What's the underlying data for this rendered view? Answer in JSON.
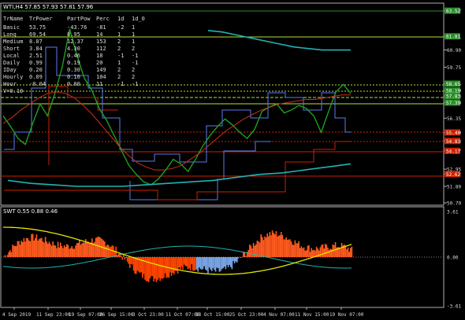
{
  "main_panel": {
    "title": "WTI,H4  57.85 57.93 57.81 57.96",
    "table": {
      "headers": [
        "TrName",
        "TrPower",
        "PartPow",
        "Perc",
        "1d",
        "1d_0"
      ],
      "rows": [
        [
          "Basic",
          "53.75",
          "-43.76",
          "-81",
          "-2",
          "1"
        ],
        [
          "Long",
          "69.54",
          "8.95",
          "14",
          "1",
          "1"
        ],
        [
          "Medium",
          "8.07",
          "12.37",
          "153",
          "2",
          "1"
        ],
        [
          "Short",
          "3.84",
          "4.30",
          "112",
          "2",
          "2"
        ],
        [
          "Local",
          "2.51",
          "0.46",
          "18",
          "-1",
          "-1"
        ],
        [
          "Daily",
          "0.99",
          "0.19",
          "20",
          "1",
          "-1"
        ],
        [
          "IDay",
          "0.20",
          "0.30",
          "149",
          "2",
          "2"
        ],
        [
          "Hourly",
          "0.09",
          "0.10",
          "104",
          "2",
          "2"
        ],
        [
          "Hour",
          "-0.04",
          "0.00",
          "11",
          "-1",
          "-1"
        ]
      ],
      "extra": "V=0.10"
    },
    "y_ticks": [
      "63.52",
      "61.81",
      "60.90",
      "59.75",
      "58.65",
      "58.19",
      "57.83",
      "57.39",
      "56.35",
      "55.40",
      "54.83",
      "54.17",
      "52.95",
      "52.62",
      "51.80",
      "50.70"
    ],
    "price_labels": [
      {
        "text": "63.52",
        "color": "#2a8f2a"
      },
      {
        "text": "61.81",
        "color": "#2a8f2a"
      },
      {
        "text": "58.65",
        "color": "#2a8f2a"
      },
      {
        "text": "58.19",
        "color": "#2a8f2a"
      },
      {
        "text": "57.83",
        "color": "#2a8f2a"
      },
      {
        "text": "57.39",
        "color": "#2a8f2a"
      },
      {
        "text": "55.40",
        "color": "#cc2200"
      },
      {
        "text": "54.83",
        "color": "#cc2200"
      },
      {
        "text": "54.17",
        "color": "#cc2200"
      },
      {
        "text": "52.62",
        "color": "#cc2200"
      }
    ]
  },
  "sub_panel": {
    "title": "SWT 0.55 0.88 0.46",
    "y_ticks": [
      "3.61",
      "0.00",
      "-3.61"
    ]
  },
  "x_axis": [
    "4 Sep 2019",
    "11 Sep 23:00",
    "19 Sep 07:00",
    "26 Sep 15:00",
    "3 Oct 23:00",
    "11 Oct 07:00",
    "18 Oct 15:00",
    "25 Oct 23:00",
    "4 Nov 07:00",
    "11 Nov 15:00",
    "19 Nov 07:00"
  ],
  "chart_data": {
    "type": "line",
    "series": [
      {
        "values": [
          56.5,
          55.8,
          55.0,
          54.6,
          56.0,
          57.3,
          56.5,
          58.0,
          59.8,
          62.3,
          60.5,
          59.0,
          58.2,
          57.0,
          56.2,
          55.2,
          54.2,
          53.2,
          52.6,
          52.1,
          51.9,
          52.3,
          52.9,
          53.6,
          53.3,
          52.8,
          53.6,
          54.5,
          55.2,
          55.8,
          56.3,
          55.9,
          55.4,
          55.0,
          55.6,
          56.8,
          57.1,
          57.3,
          56.7,
          56.9,
          57.2,
          57.0,
          56.5,
          55.4,
          56.8,
          58.1,
          58.6,
          58.0
        ]
      },
      {
        "values": [
          56.0,
          56.4,
          56.9,
          57.3,
          57.7,
          58.0,
          58.1,
          58.0,
          57.7,
          57.2,
          56.6,
          55.9,
          55.2,
          54.5,
          53.9,
          53.4,
          53.1,
          52.9,
          52.9,
          53.0,
          53.2,
          53.6,
          54.0,
          54.5,
          55.0,
          55.5,
          55.9,
          56.3,
          56.6,
          56.9,
          57.1,
          57.3,
          57.4,
          57.5,
          57.6,
          57.6,
          57.7,
          57.8,
          57.9,
          57.9
        ]
      },
      {
        "values": [
          52.2,
          52.0,
          51.9,
          51.8,
          51.8,
          51.8,
          51.9,
          52.0,
          52.1,
          52.2,
          52.4,
          52.6,
          52.7,
          52.9,
          53.1,
          53.3
        ]
      },
      {
        "values": [
          62.2,
          62.1,
          61.9,
          61.7,
          61.5,
          61.3,
          61.1,
          61.0,
          60.9,
          60.9,
          60.9
        ]
      }
    ],
    "ylim": [
      50.7,
      63.5
    ]
  }
}
